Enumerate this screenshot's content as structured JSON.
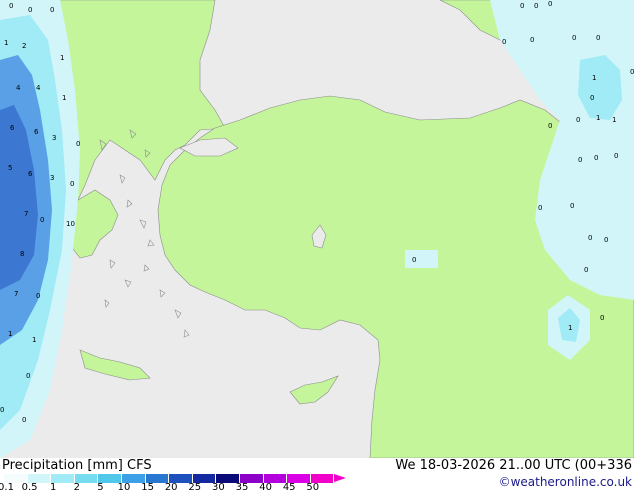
{
  "map": {
    "colors": {
      "sea": "#ebebeb",
      "land": "#c4f59b",
      "precip_light": "#d2f5fa",
      "precip_mid": "#a0ebf5",
      "precip_heavy": "#5aa0e6",
      "precip_core": "#3c78d2",
      "coast": "#8c8c8c"
    },
    "value_labels": [
      "0",
      "0",
      "0",
      "0",
      "0",
      "0",
      "1",
      "1",
      "1",
      "1",
      "1",
      "1",
      "1",
      "1",
      "1",
      "2",
      "3",
      "3",
      "4",
      "4",
      "5",
      "6",
      "6",
      "6",
      "7",
      "7",
      "8",
      "10",
      "0",
      "0",
      "0",
      "0",
      "0",
      "0",
      "0",
      "0",
      "0",
      "0",
      "0",
      "0",
      "0",
      "0",
      "0",
      "0",
      "0",
      "0",
      "0",
      "0",
      "0",
      "0",
      "0",
      "0",
      "0"
    ]
  },
  "footer": {
    "title": "Precipitation [mm] CFS",
    "valid_time": "We 18-03-2026 21..00 UTC (00+336",
    "credit": "©weatheronline.co.uk",
    "scale": [
      {
        "label": "0.1",
        "color": "#f5fcfe"
      },
      {
        "label": "0.5",
        "color": "#d2f5fa"
      },
      {
        "label": "1",
        "color": "#a0ebf5"
      },
      {
        "label": "2",
        "color": "#78dcf0"
      },
      {
        "label": "5",
        "color": "#50c8eb"
      },
      {
        "label": "10",
        "color": "#3ca0e6"
      },
      {
        "label": "15",
        "color": "#2878d2"
      },
      {
        "label": "20",
        "color": "#1e50be"
      },
      {
        "label": "25",
        "color": "#1428a0"
      },
      {
        "label": "30",
        "color": "#0a0a78"
      },
      {
        "label": "35",
        "color": "#8c00c8"
      },
      {
        "label": "40",
        "color": "#b400dc"
      },
      {
        "label": "45",
        "color": "#dc00e6"
      },
      {
        "label": "50",
        "color": "#f000c8"
      }
    ]
  }
}
